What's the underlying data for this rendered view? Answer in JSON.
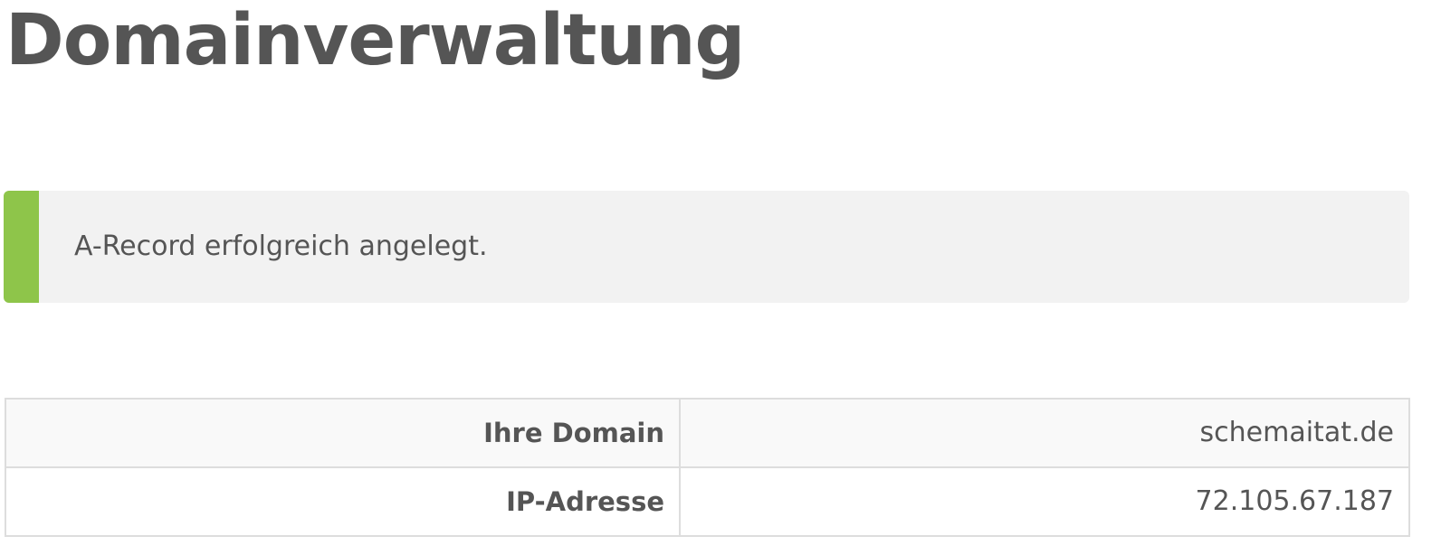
{
  "page": {
    "title": "Domainverwaltung"
  },
  "alert": {
    "message": "A-Record erfolgreich angelegt.",
    "accent_color": "#8ec54a",
    "type": "success"
  },
  "details": {
    "rows": [
      {
        "label": "Ihre Domain",
        "value": "schemaitat.de"
      },
      {
        "label": "IP-Adresse",
        "value": "72.105.67.187"
      }
    ]
  }
}
